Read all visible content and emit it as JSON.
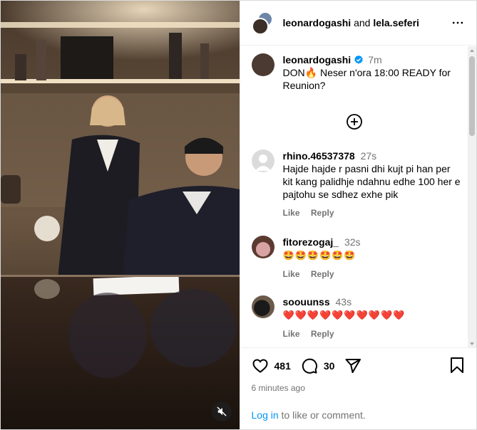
{
  "header": {
    "user1": "leonardogashi",
    "connector": "and",
    "user2": "lela.seferi"
  },
  "caption": {
    "username": "leonardogashi",
    "time": "7m",
    "text_part1": "DON",
    "text_part2": " Neser n'ora 18:00 READY for Reunion?"
  },
  "comments": [
    {
      "username": "rhino.46537378",
      "time": "27s",
      "text": "Hajde hajde r pasni dhi kujt pi han per kit kang palidhje ndahnu edhe 100 her e pajtohu se sdhez exhe pik",
      "like": "Like",
      "reply": "Reply"
    },
    {
      "username": "fitorezogaj_",
      "time": "32s",
      "text": "🤩🤩🤩🤩🤩🤩",
      "like": "Like",
      "reply": "Reply"
    },
    {
      "username": "soouunss",
      "time": "43s",
      "text": "❤️❤️❤️❤️❤️❤️❤️❤️❤️❤️",
      "like": "Like",
      "reply": "Reply"
    }
  ],
  "footer": {
    "likes": "481",
    "comments": "30",
    "timestamp": "6 minutes ago",
    "login_link": "Log in",
    "login_rest": " to like or comment."
  },
  "icons": {
    "more": "more-horizontal-icon",
    "verified": "verified-badge-icon",
    "add": "add-circle-icon",
    "heart": "heart-icon",
    "comment": "comment-icon",
    "share": "share-icon",
    "bookmark": "bookmark-icon",
    "mute": "mute-icon"
  },
  "colors": {
    "link": "#0095f6",
    "verified": "#0095f6",
    "secondary_text": "#737373",
    "heart_emoji": "#e0245e"
  }
}
